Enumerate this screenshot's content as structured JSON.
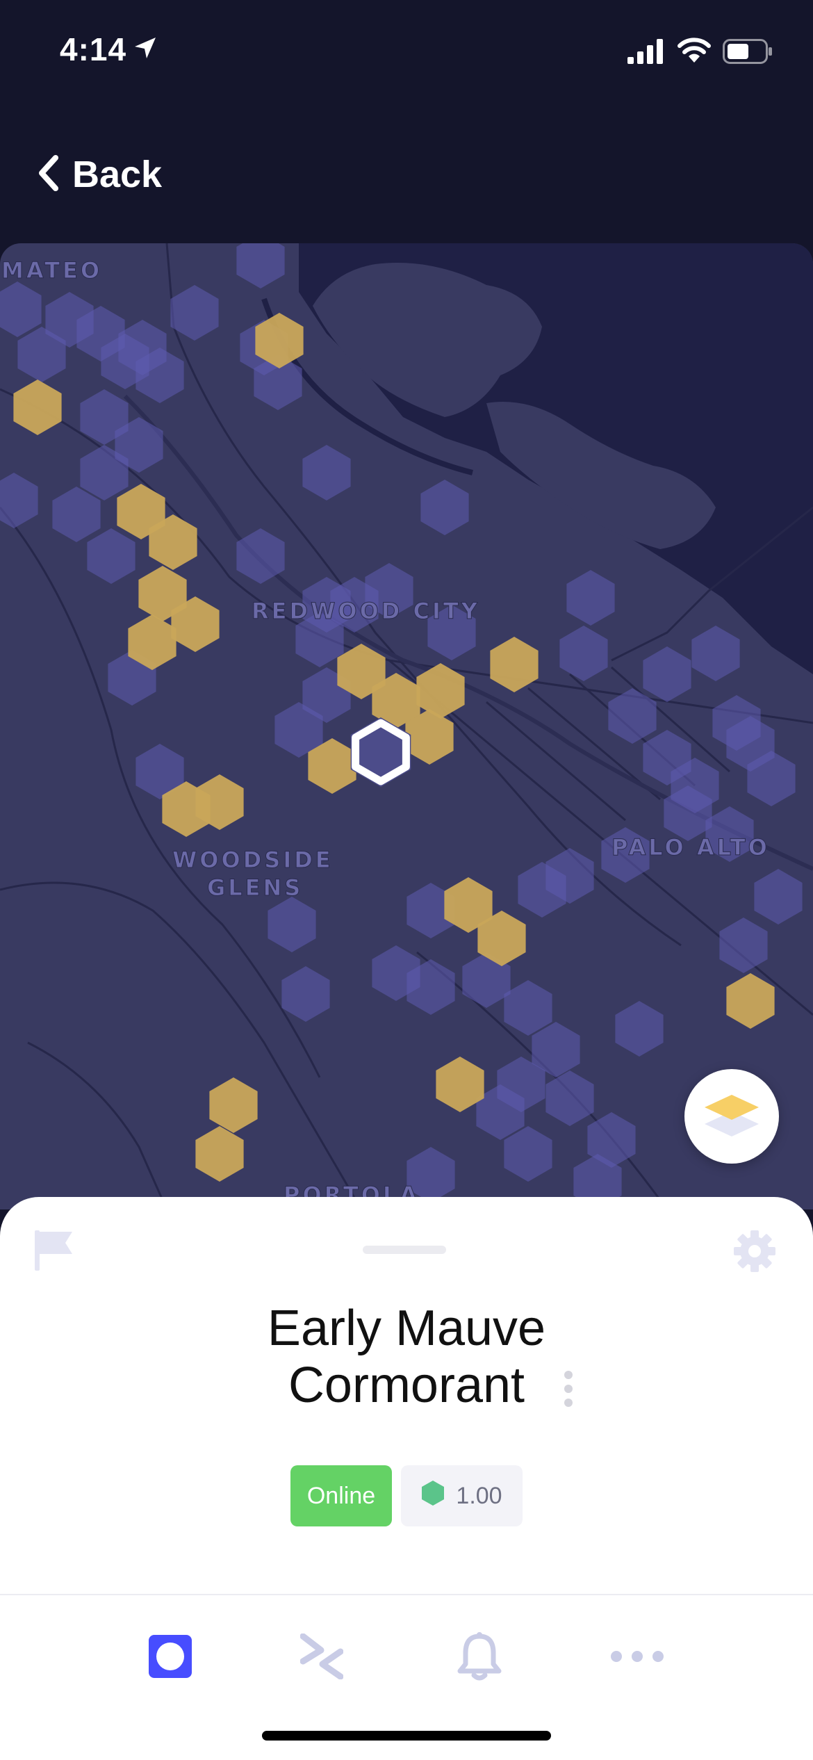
{
  "status_bar": {
    "time": "4:14",
    "icons": [
      "location-arrow-icon",
      "cellular-signal-icon",
      "wifi-icon",
      "battery-icon"
    ]
  },
  "nav": {
    "back_label": "Back",
    "back_icon": "chevron-left-icon"
  },
  "map": {
    "place_labels": [
      "MATEO",
      "REDWOOD CITY",
      "WOODSIDE",
      "GLENS",
      "PALO ALTO",
      "PORTOLA"
    ],
    "colors": {
      "background": "#393a61",
      "water": "#1f2045",
      "hex_purple": "#5e5bb0",
      "hex_gold": "#c9a75a",
      "selected_outline": "#ffffff"
    },
    "layers_button_icon": "layers-icon"
  },
  "sheet": {
    "title_line1": "Early Mauve",
    "title_line2": "Cormorant",
    "status_badge": "Online",
    "reward_scale": "1.00",
    "icons": [
      "flag-icon",
      "gear-icon",
      "more-vertical-icon"
    ]
  },
  "tab_bar": {
    "tabs": [
      {
        "name": "hotspot",
        "icon": "hotspot-icon",
        "active": true
      },
      {
        "name": "activity",
        "icon": "transfer-icon",
        "active": false
      },
      {
        "name": "notifications",
        "icon": "bell-icon",
        "active": false
      },
      {
        "name": "more",
        "icon": "more-horizontal-icon",
        "active": false
      }
    ],
    "colors": {
      "active": "#474dff",
      "inactive": "#c9cce6"
    }
  }
}
